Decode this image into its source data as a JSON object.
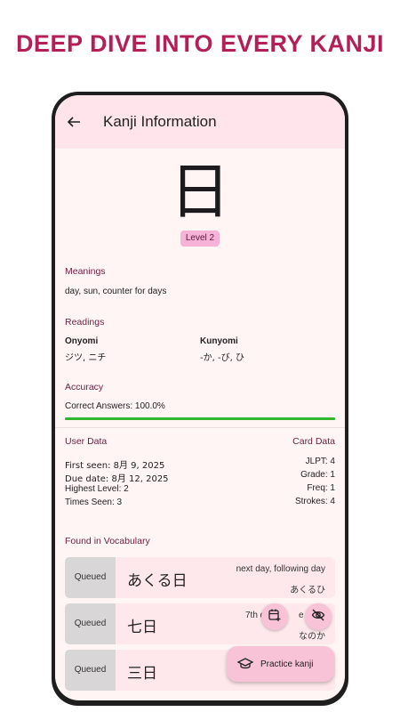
{
  "headline": "DEEP DIVE INTO EVERY KANJI",
  "appbar": {
    "title": "Kanji Information"
  },
  "kanji": {
    "character": "日",
    "level": "Level 2"
  },
  "meanings": {
    "title": "Meanings",
    "text": "day, sun, counter for days"
  },
  "readings": {
    "title": "Readings",
    "onyomi_label": "Onyomi",
    "onyomi_value": "ジツ, ニチ",
    "kunyomi_label": "Kunyomi",
    "kunyomi_value": "-か, -び, ひ"
  },
  "accuracy": {
    "title": "Accuracy",
    "text": "Correct Answers: 100.0%",
    "percent": 100
  },
  "user_data": {
    "title": "User Data",
    "first_seen": "First seen: 8月 9, 2025",
    "due_date": "Due date: 8月 12, 2025",
    "highest_level": "Highest Level: 2",
    "times_seen": "Times Seen: 3"
  },
  "card_data": {
    "title": "Card Data",
    "jlpt": "JLPT: 4",
    "grade": "Grade: 1",
    "freq": "Freq: 1",
    "strokes": "Strokes: 4"
  },
  "vocabulary": {
    "title": "Found in Vocabulary",
    "items": [
      {
        "status": "Queued",
        "word": "あくる日",
        "meaning": "next day, following day",
        "reading": "あくるひ"
      },
      {
        "status": "Queued",
        "word": "七日",
        "meaning": "7th da",
        "meaning_tail": "e m",
        "reading": "なのか"
      },
      {
        "status": "Queued",
        "word": "三日",
        "meaning": "",
        "reading": ""
      }
    ]
  },
  "actions": {
    "practice_label": "Practice kanji"
  },
  "colors": {
    "headline": "#b51f58",
    "appbar": "#ffe4ec",
    "screen": "#fff5f5",
    "badge": "#f7b2d7",
    "progress": "#34b52e",
    "fab": "#f9c3d7"
  }
}
